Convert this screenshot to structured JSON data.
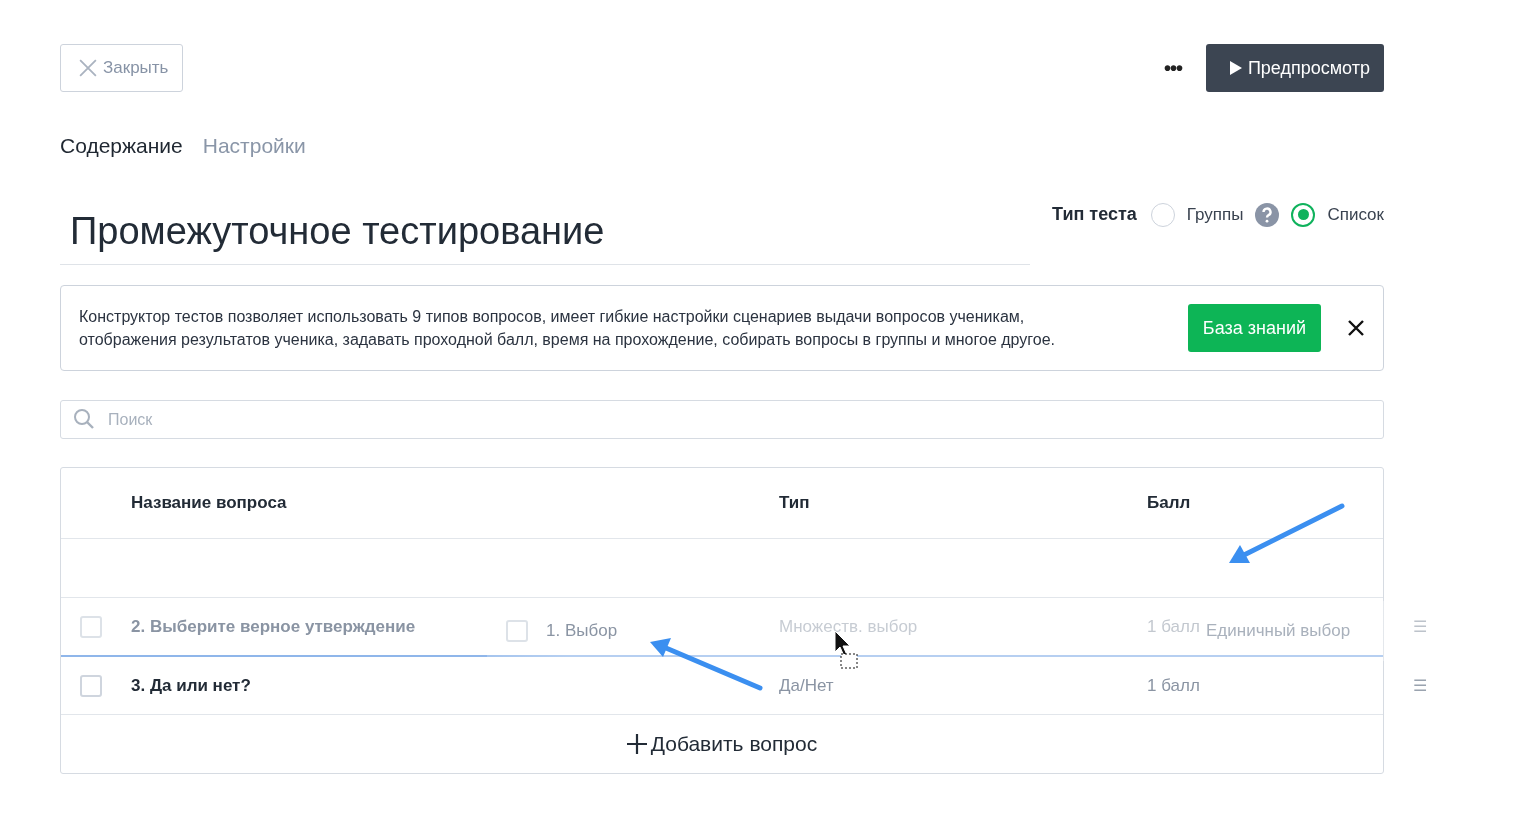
{
  "header": {
    "close_button": "Закрыть",
    "more_button": "•••",
    "preview_button": "Предпросмотр"
  },
  "tabs": [
    {
      "label": "Содержание",
      "selected": true
    },
    {
      "label": "Настройки",
      "selected": false
    }
  ],
  "title": "Промежуточное тестирование",
  "test_type": {
    "label": "Тип теста",
    "options": [
      {
        "label": "Группы",
        "selected": false,
        "help": true
      },
      {
        "label": "Список",
        "selected": true,
        "help": false
      }
    ]
  },
  "notice": {
    "text": "Конструктор тестов позволяет использовать 9 типов вопросов, имеет гибкие настройки сценариев выдачи вопросов ученикам, отображения результатов ученика, задавать проходной балл, время на прохождение, собирать вопросы в группы и многое другое.",
    "button": "База знаний"
  },
  "search": {
    "placeholder": "Поиск"
  },
  "table": {
    "columns": [
      "Название вопроса",
      "Тип",
      "Балл"
    ],
    "rows": [
      {
        "kind": "empty"
      },
      {
        "kind": "question",
        "name": "2. Выберите верное утверждение",
        "type": "Множеств. выбор",
        "score": "1 балл",
        "checked": false,
        "faded": true,
        "handle": "☰"
      },
      {
        "kind": "question",
        "name": "3. Да или нет?",
        "type": "Да/Нет",
        "score": "1 балл",
        "checked": false,
        "faded": false,
        "handle": "☰"
      }
    ],
    "drag_ghost": {
      "name": "1. Выбор",
      "type": "Единичный выбор",
      "checked": false
    },
    "add_button": "Добавить вопрос"
  }
}
